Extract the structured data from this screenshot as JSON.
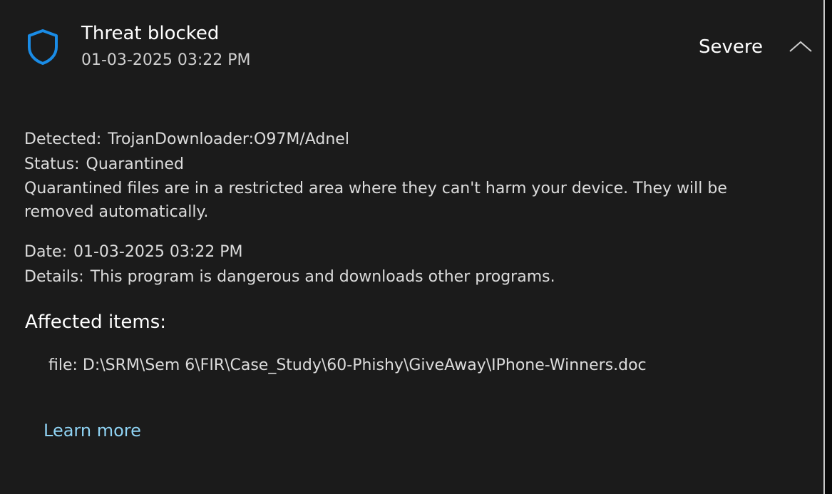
{
  "header": {
    "title": "Threat blocked",
    "timestamp": "01-03-2025 03:22 PM",
    "severity": "Severe",
    "shield_color": "#1a8ce6"
  },
  "details": {
    "detected_label": "Detected:",
    "detected_value": "TrojanDownloader:O97M/Adnel",
    "status_label": "Status:",
    "status_value": "Quarantined",
    "status_note": "Quarantined files are in a restricted area where they can't harm your device. They will be removed automatically.",
    "date_label": "Date:",
    "date_value": "01-03-2025 03:22 PM",
    "details_label": "Details:",
    "details_value": "This program is dangerous and downloads other programs."
  },
  "affected": {
    "title": "Affected items:",
    "file_label": "file:",
    "file_path": "D:\\SRM\\Sem 6\\FIR\\Case_Study\\60-Phishy\\GiveAway\\IPhone-Winners.doc"
  },
  "links": {
    "learn_more": "Learn more",
    "link_color": "#8fd3f4"
  },
  "icons": {
    "shield": "shield-icon",
    "collapse": "chevron-up-icon"
  }
}
